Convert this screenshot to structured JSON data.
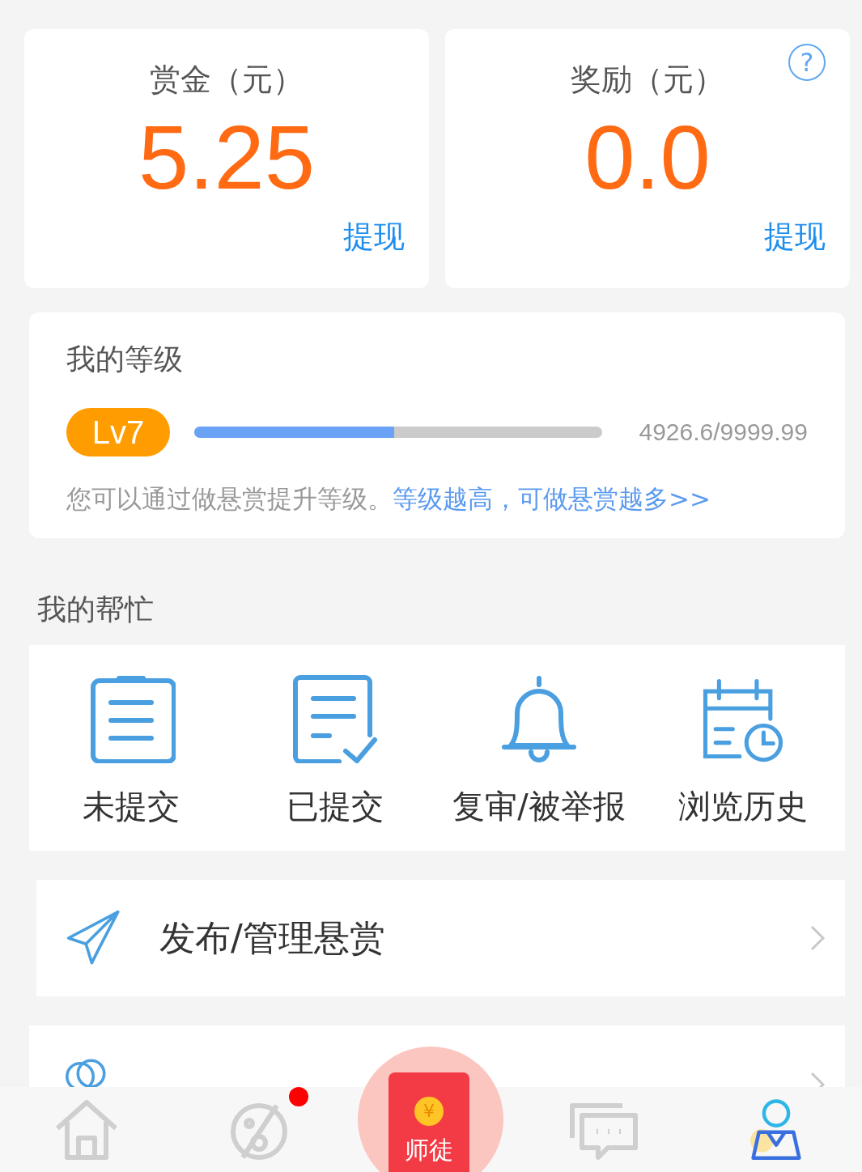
{
  "balance_cards": [
    {
      "title": "赏金（元）",
      "amount": "5.25",
      "action": "提现"
    },
    {
      "title": "奖励（元）",
      "amount": "0.0",
      "action": "提现",
      "help": "?"
    }
  ],
  "level": {
    "title": "我的等级",
    "badge": "Lv7",
    "level": 0.49,
    "reading": "4926.6/9999.99",
    "hint": "您可以通过做悬赏提升等级。",
    "link": "等级越高，可做悬赏越多>>"
  },
  "section_title": "我的帮忙",
  "shortcuts": [
    {
      "kind": "clipboard",
      "label": "未提交"
    },
    {
      "kind": "checklist",
      "label": "已提交"
    },
    {
      "kind": "bell",
      "label": "复审/被举报"
    },
    {
      "kind": "calendar",
      "label": "浏览历史"
    }
  ],
  "menu": [
    {
      "kind": "send",
      "label": "发布/管理悬赏"
    },
    {
      "kind": "people"
    }
  ],
  "tab_bar": [
    {
      "kind": "home",
      "selected": false,
      "badge": false
    },
    {
      "kind": "planet",
      "selected": false,
      "badge": true
    },
    {
      "kind": "envelope",
      "coin": "¥",
      "label": "师徒",
      "selected": false,
      "badge": false
    },
    {
      "kind": "chat",
      "selected": false,
      "badge": false
    },
    {
      "kind": "profile",
      "selected": true,
      "badge": false
    }
  ]
}
